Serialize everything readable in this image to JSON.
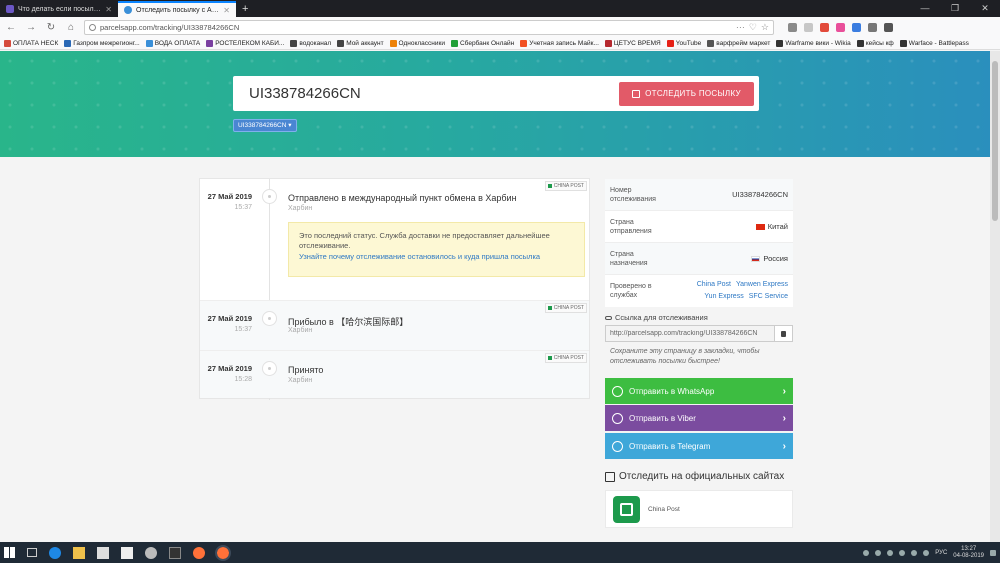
{
  "browser": {
    "tabs": [
      {
        "title": "Что делать если посылка в...",
        "active": false
      },
      {
        "title": "Отследить посылку с Алиэкс...",
        "active": true
      }
    ],
    "new_tab": "+",
    "url": "parcelsapp.com/tracking/UI338784266CN",
    "bookmarks": [
      {
        "label": "ОПЛАТА НЕСК",
        "color": "#d54b3c"
      },
      {
        "label": "Газпром межрегионг...",
        "color": "#2a68b5"
      },
      {
        "label": "ВОДА ОПЛАТА",
        "color": "#3a8fd8"
      },
      {
        "label": "РОСТЕЛЕКОМ КАБИ...",
        "color": "#7a3fa0"
      },
      {
        "label": "водоканал",
        "color": "#444"
      },
      {
        "label": "Мой аккаунт",
        "color": "#444"
      },
      {
        "label": "Одноклассники",
        "color": "#ee8208"
      },
      {
        "label": "Сбербанк Онлайн",
        "color": "#21a038"
      },
      {
        "label": "Учетная запись Майк...",
        "color": "#f25022"
      },
      {
        "label": "ЦЕТУС ВРЕМЯ",
        "color": "#b5282f"
      },
      {
        "label": "YouTube",
        "color": "#e62117"
      },
      {
        "label": "варфрейм маркет",
        "color": "#555"
      },
      {
        "label": "Warframe вики - Wikia",
        "color": "#333"
      },
      {
        "label": "кейсы кф",
        "color": "#333"
      },
      {
        "label": "Warface - Battlepass",
        "color": "#333"
      }
    ]
  },
  "search": {
    "value": "UI338784266CN",
    "button_label": "ОТСЛЕДИТЬ ПОСЫЛКУ",
    "chip": "UI338784266CN ▾"
  },
  "events": [
    {
      "date": "27 Май 2019",
      "time": "15:37",
      "title": "Отправлено в международный пункт обмена в Харбин",
      "location": "Харбин",
      "source": "CHINA POST"
    },
    {
      "date": "27 Май 2019",
      "time": "15:37",
      "title": "Прибыло в 【哈尔滨国际邮】",
      "location": "Харбин",
      "source": "CHINA POST"
    },
    {
      "date": "27 Май 2019",
      "time": "15:28",
      "title": "Принято",
      "location": "Харбин",
      "source": "CHINA POST"
    }
  ],
  "notice": {
    "text": "Это последний статус. Служба доставки не предоставляет дальнейшее отслеживание.",
    "link": "Узнайте почему отслеживание остановилось и куда пришла посылка"
  },
  "info": {
    "tracking_label": "Номер отслеживания",
    "tracking_value": "UI338784266CN",
    "origin_label": "Страна отправления",
    "origin_value": "Китай",
    "dest_label": "Страна назначения",
    "dest_value": "Россия",
    "checked_label": "Проверено в службах",
    "carriers_row1": [
      "China Post",
      "Yanwen Express"
    ],
    "carriers_row2": [
      "Yun Express",
      "SFC Service"
    ]
  },
  "link": {
    "label": "Ссылка для отслеживания",
    "value": "http://parcelsapp.com/tracking/UI338784266CN",
    "hint": "Сохраните эту страницу в закладки, чтобы отслеживать посылки быстрее!"
  },
  "share": {
    "whatsapp": "Отправить в WhatsApp",
    "viber": "Отправить в Viber",
    "telegram": "Отправить в Telegram",
    "arrow": "›"
  },
  "official": {
    "title": "Отследить на официальных сайтах",
    "carrier": "China Post"
  },
  "taskbar": {
    "lang": "РУС",
    "time": "13:27",
    "date": "04-08-2019"
  },
  "colors": {
    "accent_red": "#e25a68",
    "whatsapp": "#3dbd41",
    "viber": "#7b4c9f",
    "telegram": "#3ea7d9",
    "china_post": "#1d9a4c"
  }
}
